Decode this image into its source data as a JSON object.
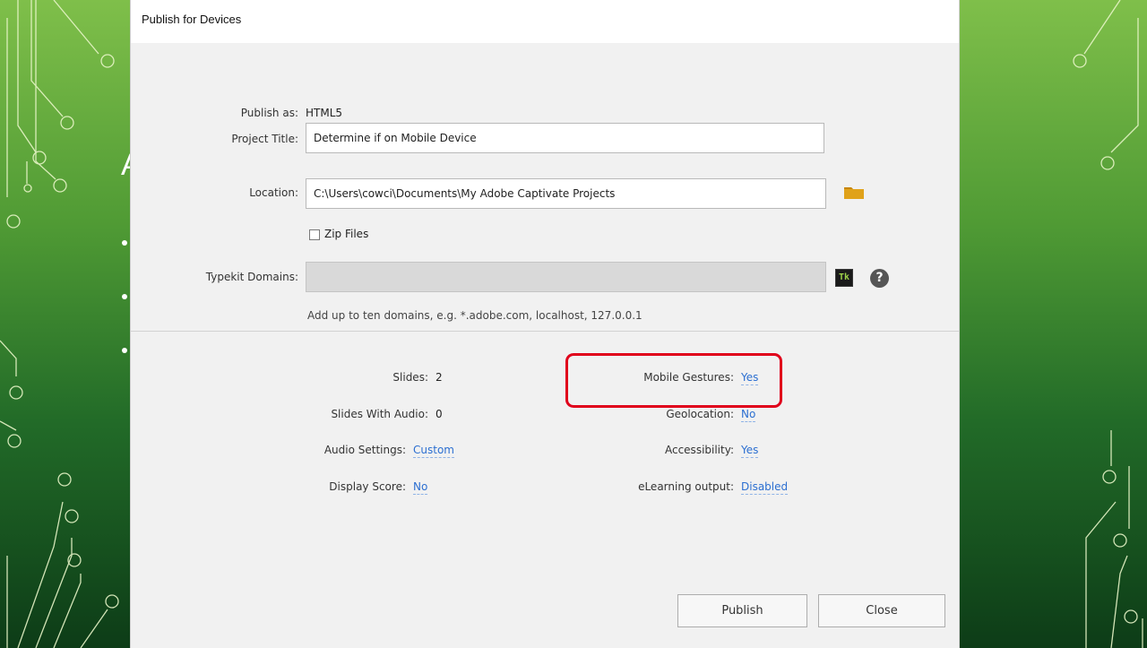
{
  "dialog": {
    "title": "Publish for Devices",
    "publish_as": {
      "label": "Publish as:",
      "value": "HTML5"
    },
    "project_title": {
      "label": "Project Title:",
      "value": "Determine if on Mobile Device"
    },
    "location": {
      "label": "Location:",
      "value": "C:\\Users\\cowci\\Documents\\My Adobe Captivate Projects",
      "icon": "folder-icon"
    },
    "zip_files": {
      "label": "Zip Files",
      "checked": false
    },
    "typekit": {
      "label": "Typekit Domains:",
      "value": "",
      "tk_icon": "Tk",
      "help_icon": "?",
      "hint": "Add up to ten domains, e.g. *.adobe.com, localhost, 127.0.0.1"
    },
    "summary_left": [
      {
        "label": "Slides:",
        "value": "2",
        "link": false
      },
      {
        "label": "Slides With Audio:",
        "value": "0",
        "link": false
      },
      {
        "label": "Audio Settings:",
        "value": "Custom",
        "link": true
      },
      {
        "label": "Display Score:",
        "value": "No",
        "link": true
      }
    ],
    "summary_right": [
      {
        "label": "Mobile Gestures:",
        "value": "Yes",
        "link": true
      },
      {
        "label": "Geolocation:",
        "value": "No",
        "link": true
      },
      {
        "label": "Accessibility:",
        "value": "Yes",
        "link": true
      },
      {
        "label": "eLearning output:",
        "value": "Disabled",
        "link": true
      }
    ],
    "buttons": {
      "publish": "Publish",
      "close": "Close"
    }
  },
  "slide_background": {
    "partial_title_char": "A",
    "bullet_count": 3
  },
  "colors": {
    "link": "#2c6fd1",
    "highlight": "#e0001b",
    "folder": "#e0a21a"
  }
}
